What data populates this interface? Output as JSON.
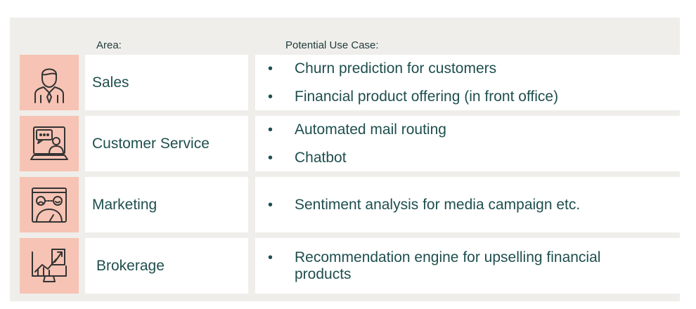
{
  "header": {
    "area_label": "Area:",
    "use_case_label": "Potential Use Case:"
  },
  "rows": [
    {
      "area": "Sales",
      "icon": "salesperson-icon",
      "use_cases": [
        "Churn prediction for customers",
        "Financial product offering (in front office)"
      ]
    },
    {
      "area": "Customer Service",
      "icon": "customer-service-chat-icon",
      "use_cases": [
        "Automated mail routing",
        "Chatbot"
      ]
    },
    {
      "area": "Marketing",
      "icon": "sentiment-gauge-icon",
      "use_cases": [
        "Sentiment analysis for media campaign etc."
      ]
    },
    {
      "area": "Brokerage",
      "icon": "growth-chart-monitor-icon",
      "use_cases": [
        "Recommendation engine for upselling financial products"
      ]
    }
  ],
  "colors": {
    "icon_bg": "#f6c3b4",
    "panel_bg": "#efeeea",
    "text": "#1f4e4e"
  }
}
